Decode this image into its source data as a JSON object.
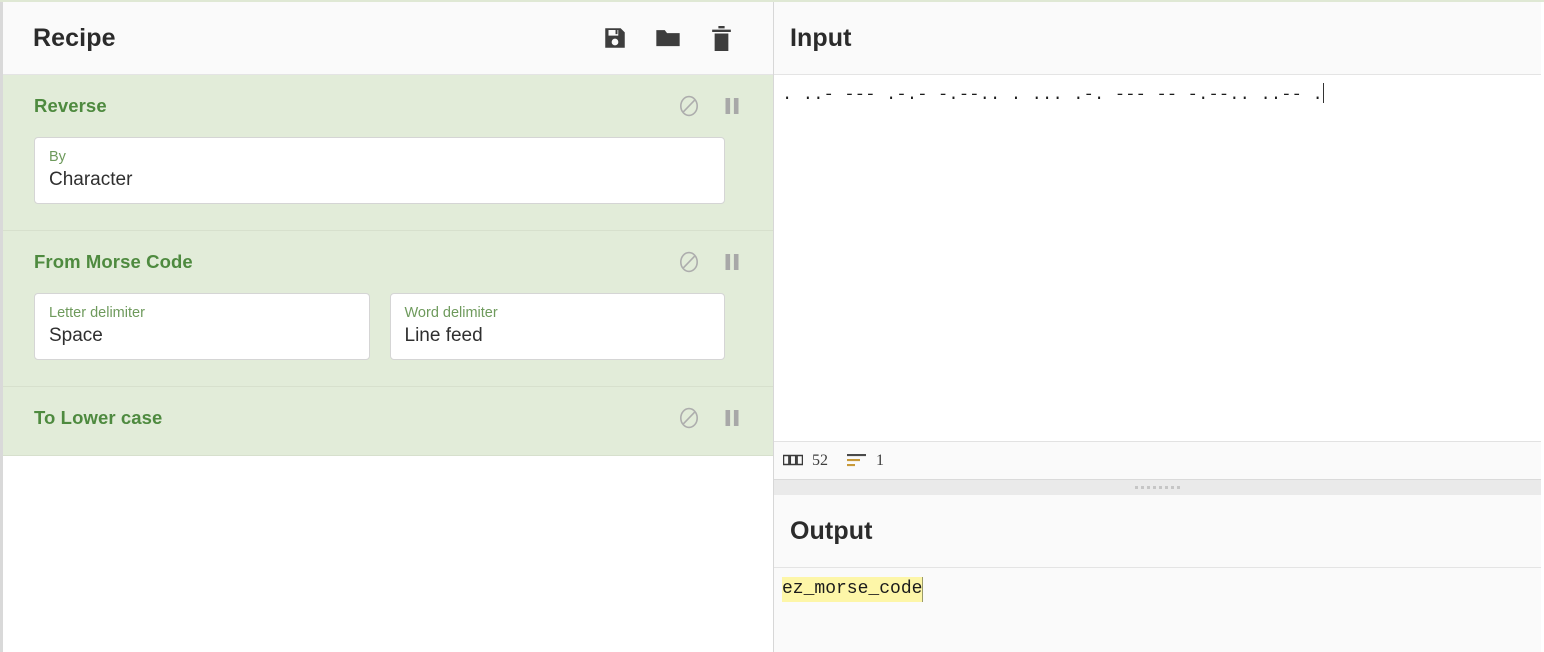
{
  "recipe": {
    "title": "Recipe",
    "actions": [
      {
        "name": "save-recipe-button",
        "icon": "floppy-disk-icon",
        "label": "Save recipe"
      },
      {
        "name": "load-recipe-button",
        "icon": "folder-icon",
        "label": "Load recipe"
      },
      {
        "name": "clear-recipe-button",
        "icon": "trash-icon",
        "label": "Clear recipe"
      }
    ],
    "operations": [
      {
        "title": "Reverse",
        "disable_icon": "disable-circle-slash-icon",
        "pause_icon": "breakpoint-pause-icon",
        "args": [
          {
            "label": "By",
            "value": "Character",
            "width": "wide"
          }
        ]
      },
      {
        "title": "From Morse Code",
        "disable_icon": "disable-circle-slash-icon",
        "pause_icon": "breakpoint-pause-icon",
        "args": [
          {
            "label": "Letter delimiter",
            "value": "Space",
            "width": "half"
          },
          {
            "label": "Word delimiter",
            "value": "Line feed",
            "width": "half"
          }
        ]
      },
      {
        "title": "To Lower case",
        "disable_icon": "disable-circle-slash-icon",
        "pause_icon": "breakpoint-pause-icon",
        "args": []
      }
    ]
  },
  "input": {
    "title": "Input",
    "text": ". ..- --- .-.- -.--.. . ... .-. --- -- -.--.. ..-- .",
    "status": {
      "length_icon": "abc-character-count-icon",
      "length": "52",
      "lines_icon": "line-count-icon",
      "lines": "1"
    }
  },
  "output": {
    "title": "Output",
    "text": "ez_morse_code",
    "highlight_color": "#fdf6a8"
  },
  "theme": {
    "op_background": "#e2ecd9",
    "op_title_color": "#4e8a3f",
    "arg_label_color": "#6e9a5c",
    "panel_header_bg": "#fafafa"
  }
}
